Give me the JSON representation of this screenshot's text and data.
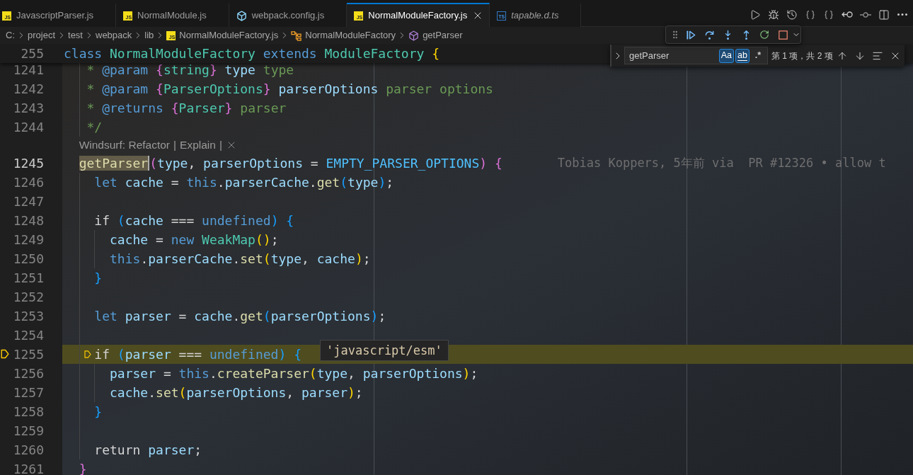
{
  "tabs": [
    {
      "label": "JavascriptParser.js",
      "kind": "js",
      "badge": "JS",
      "selected": false,
      "preview": false
    },
    {
      "label": "NormalModule.js",
      "kind": "js",
      "badge": "JS",
      "selected": false,
      "preview": false
    },
    {
      "label": "webpack.config.js",
      "kind": "webpack",
      "selected": false,
      "preview": false
    },
    {
      "label": "NormalModuleFactory.js",
      "kind": "js",
      "badge": "JS",
      "selected": true,
      "preview": false
    },
    {
      "label": "tapable.d.ts",
      "kind": "ts",
      "badge": "TS",
      "selected": false,
      "preview": true
    }
  ],
  "breadcrumbs": [
    {
      "label": "C:",
      "kind": "folder"
    },
    {
      "label": "project",
      "kind": "folder"
    },
    {
      "label": "test",
      "kind": "folder"
    },
    {
      "label": "webpack",
      "kind": "folder"
    },
    {
      "label": "lib",
      "kind": "folder"
    },
    {
      "label": "NormalModuleFactory.js",
      "kind": "js",
      "badge": "JS"
    },
    {
      "label": "NormalModuleFactory",
      "kind": "class"
    },
    {
      "label": "getParser",
      "kind": "method"
    }
  ],
  "find": {
    "replace_expanded": false,
    "value": "getParser",
    "toggles": [
      {
        "kind": "case",
        "label": "Aa",
        "selected": true
      },
      {
        "kind": "word",
        "label": "ab",
        "selected": true
      },
      {
        "kind": "regex",
        "label": ".*",
        "selected": false
      }
    ],
    "result": "第 1 项，共 2 项"
  },
  "editor": {
    "sticky": {
      "number": "255",
      "tokens": [
        {
          "text": "class ",
          "kind": "keyword"
        },
        {
          "text": "NormalModuleFactory ",
          "kind": "type"
        },
        {
          "text": "extends ",
          "kind": "keyword"
        },
        {
          "text": "ModuleFactory ",
          "kind": "type"
        },
        {
          "text": "{",
          "kind": "brace1"
        }
      ]
    },
    "lines": [
      {
        "number": "1241",
        "cursor": false,
        "paused": false,
        "tokens": [
          {
            "text": "   * ",
            "kind": "comment"
          },
          {
            "text": "@param ",
            "kind": "tag"
          },
          {
            "text": "{",
            "kind": "brace2"
          },
          {
            "text": "string",
            "kind": "type"
          },
          {
            "text": "} ",
            "kind": "brace2"
          },
          {
            "text": "type ",
            "kind": "variable"
          },
          {
            "text": "type",
            "kind": "comment"
          }
        ]
      },
      {
        "number": "1242",
        "cursor": false,
        "paused": false,
        "tokens": [
          {
            "text": "   * ",
            "kind": "comment"
          },
          {
            "text": "@param ",
            "kind": "tag"
          },
          {
            "text": "{",
            "kind": "brace2"
          },
          {
            "text": "ParserOptions",
            "kind": "type"
          },
          {
            "text": "} ",
            "kind": "brace2"
          },
          {
            "text": "parserOptions ",
            "kind": "variable"
          },
          {
            "text": "parser options",
            "kind": "comment"
          }
        ]
      },
      {
        "number": "1243",
        "cursor": false,
        "paused": false,
        "tokens": [
          {
            "text": "   * ",
            "kind": "comment"
          },
          {
            "text": "@returns ",
            "kind": "tag"
          },
          {
            "text": "{",
            "kind": "brace2"
          },
          {
            "text": "Parser",
            "kind": "type"
          },
          {
            "text": "} ",
            "kind": "brace2"
          },
          {
            "text": "parser",
            "kind": "comment"
          }
        ]
      },
      {
        "number": "1244",
        "cursor": false,
        "paused": false,
        "tokens": [
          {
            "text": "   */",
            "kind": "comment"
          }
        ]
      },
      {
        "number": "1245",
        "cursor": true,
        "paused": false,
        "codelens": {
          "actions": [
            "Windsurf: Refactor",
            "Explain"
          ],
          "separators": [
            "|",
            "|"
          ]
        },
        "blame": "Tobias Koppers, 5年前 via  PR #12326 • allow t",
        "tokens": [
          {
            "text": "  getParser",
            "kind": "match"
          },
          {
            "text": "(",
            "kind": "brace2"
          },
          {
            "text": "type",
            "kind": "variable"
          },
          {
            "text": ", ",
            "kind": "plain"
          },
          {
            "text": "parserOptions ",
            "kind": "variable"
          },
          {
            "text": "= ",
            "kind": "plain"
          },
          {
            "text": "EMPTY_PARSER_OPTIONS",
            "kind": "constant"
          },
          {
            "text": ") ",
            "kind": "brace2"
          },
          {
            "text": "{",
            "kind": "brace2"
          }
        ]
      },
      {
        "number": "1246",
        "cursor": false,
        "paused": false,
        "tokens": [
          {
            "text": "    let ",
            "kind": "keyword"
          },
          {
            "text": "cache ",
            "kind": "variable"
          },
          {
            "text": "= ",
            "kind": "plain"
          },
          {
            "text": "this",
            "kind": "keyword"
          },
          {
            "text": ".",
            "kind": "plain"
          },
          {
            "text": "parserCache",
            "kind": "variable"
          },
          {
            "text": ".",
            "kind": "plain"
          },
          {
            "text": "get",
            "kind": "function"
          },
          {
            "text": "(",
            "kind": "brace3"
          },
          {
            "text": "type",
            "kind": "variable"
          },
          {
            "text": ")",
            "kind": "brace3"
          },
          {
            "text": ";",
            "kind": "plain"
          }
        ]
      },
      {
        "number": "1247",
        "cursor": false,
        "paused": false
      },
      {
        "number": "1248",
        "cursor": false,
        "paused": false,
        "tokens": [
          {
            "text": "    if ",
            "kind": "control"
          },
          {
            "text": "(",
            "kind": "brace3"
          },
          {
            "text": "cache ",
            "kind": "variable"
          },
          {
            "text": "=== ",
            "kind": "plain"
          },
          {
            "text": "undefined",
            "kind": "keyword"
          },
          {
            "text": ") ",
            "kind": "brace3"
          },
          {
            "text": "{",
            "kind": "brace3"
          }
        ]
      },
      {
        "number": "1249",
        "cursor": false,
        "paused": false,
        "tokens": [
          {
            "text": "      cache ",
            "kind": "variable"
          },
          {
            "text": "= ",
            "kind": "plain"
          },
          {
            "text": "new ",
            "kind": "keyword"
          },
          {
            "text": "WeakMap",
            "kind": "type"
          },
          {
            "text": "()",
            "kind": "brace1"
          },
          {
            "text": ";",
            "kind": "plain"
          }
        ]
      },
      {
        "number": "1250",
        "cursor": false,
        "paused": false,
        "tokens": [
          {
            "text": "      this",
            "kind": "keyword"
          },
          {
            "text": ".",
            "kind": "plain"
          },
          {
            "text": "parserCache",
            "kind": "variable"
          },
          {
            "text": ".",
            "kind": "plain"
          },
          {
            "text": "set",
            "kind": "function"
          },
          {
            "text": "(",
            "kind": "brace1"
          },
          {
            "text": "type",
            "kind": "variable"
          },
          {
            "text": ", ",
            "kind": "plain"
          },
          {
            "text": "cache",
            "kind": "variable"
          },
          {
            "text": ")",
            "kind": "brace1"
          },
          {
            "text": ";",
            "kind": "plain"
          }
        ]
      },
      {
        "number": "1251",
        "cursor": false,
        "paused": false,
        "tokens": [
          {
            "text": "    }",
            "kind": "brace3"
          }
        ]
      },
      {
        "number": "1252",
        "cursor": false,
        "paused": false
      },
      {
        "number": "1253",
        "cursor": false,
        "paused": false,
        "tokens": [
          {
            "text": "    let ",
            "kind": "keyword"
          },
          {
            "text": "parser ",
            "kind": "variable"
          },
          {
            "text": "= ",
            "kind": "plain"
          },
          {
            "text": "cache",
            "kind": "variable"
          },
          {
            "text": ".",
            "kind": "plain"
          },
          {
            "text": "get",
            "kind": "function"
          },
          {
            "text": "(",
            "kind": "brace3"
          },
          {
            "text": "parserOptions",
            "kind": "variable"
          },
          {
            "text": ")",
            "kind": "brace3"
          },
          {
            "text": ";",
            "kind": "plain"
          }
        ]
      },
      {
        "number": "1254",
        "cursor": false,
        "paused": false
      },
      {
        "number": "1255",
        "cursor": false,
        "paused": true,
        "hover": "'javascript/esm'",
        "tokens": [
          {
            "text": "    if ",
            "kind": "control"
          },
          {
            "text": "(",
            "kind": "brace3"
          },
          {
            "text": "parser ",
            "kind": "variable"
          },
          {
            "text": "=== ",
            "kind": "plain"
          },
          {
            "text": "undefined",
            "kind": "keyword"
          },
          {
            "text": ") ",
            "kind": "brace3"
          },
          {
            "text": "{",
            "kind": "brace3"
          }
        ]
      },
      {
        "number": "1256",
        "cursor": false,
        "paused": false,
        "tokens": [
          {
            "text": "      parser ",
            "kind": "variable"
          },
          {
            "text": "= ",
            "kind": "plain"
          },
          {
            "text": "this",
            "kind": "keyword"
          },
          {
            "text": ".",
            "kind": "plain"
          },
          {
            "text": "createParser",
            "kind": "function"
          },
          {
            "text": "(",
            "kind": "brace1"
          },
          {
            "text": "type",
            "kind": "variable"
          },
          {
            "text": ", ",
            "kind": "plain"
          },
          {
            "text": "parserOptions",
            "kind": "variable"
          },
          {
            "text": ")",
            "kind": "brace1"
          },
          {
            "text": ";",
            "kind": "plain"
          }
        ]
      },
      {
        "number": "1257",
        "cursor": false,
        "paused": false,
        "tokens": [
          {
            "text": "      cache",
            "kind": "variable"
          },
          {
            "text": ".",
            "kind": "plain"
          },
          {
            "text": "set",
            "kind": "function"
          },
          {
            "text": "(",
            "kind": "brace1"
          },
          {
            "text": "parserOptions",
            "kind": "variable"
          },
          {
            "text": ", ",
            "kind": "plain"
          },
          {
            "text": "parser",
            "kind": "variable"
          },
          {
            "text": ")",
            "kind": "brace1"
          },
          {
            "text": ";",
            "kind": "plain"
          }
        ]
      },
      {
        "number": "1258",
        "cursor": false,
        "paused": false,
        "tokens": [
          {
            "text": "    }",
            "kind": "brace3"
          }
        ]
      },
      {
        "number": "1259",
        "cursor": false,
        "paused": false
      },
      {
        "number": "1260",
        "cursor": false,
        "paused": false,
        "tokens": [
          {
            "text": "    return ",
            "kind": "control"
          },
          {
            "text": "parser",
            "kind": "variable"
          },
          {
            "text": ";",
            "kind": "plain"
          }
        ]
      },
      {
        "number": "1261",
        "cursor": false,
        "paused": false,
        "tokens": [
          {
            "text": "  }",
            "kind": "brace2"
          }
        ]
      }
    ]
  }
}
